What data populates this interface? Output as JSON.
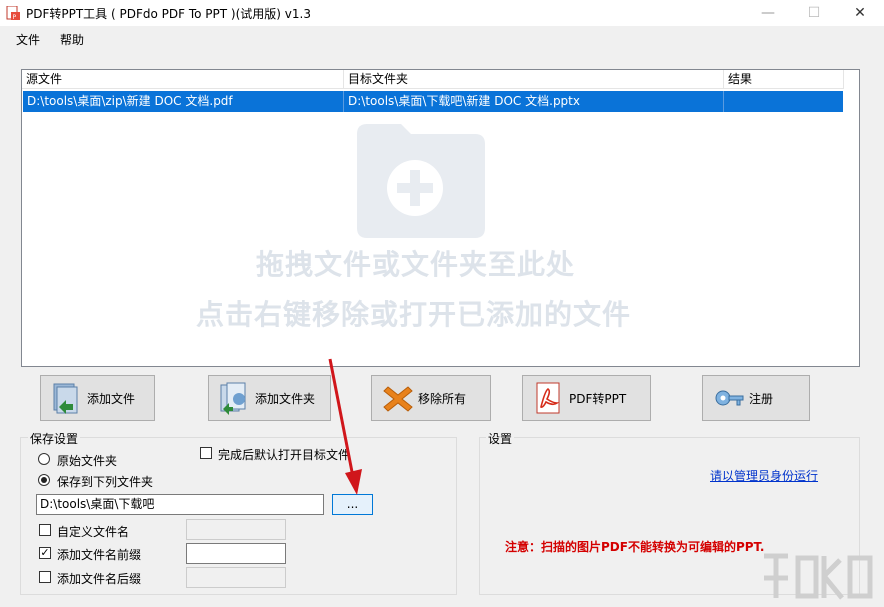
{
  "window": {
    "title": "PDF转PPT工具 ( PDFdo PDF To PPT )(试用版) v1.3",
    "minimize": "—",
    "maximize": "☐",
    "close": "✕"
  },
  "menu": [
    "文件",
    "帮助"
  ],
  "table": {
    "columns": [
      "源文件",
      "目标文件夹",
      "结果"
    ],
    "rows": [
      {
        "source": "D:\\tools\\桌面\\zip\\新建 DOC 文档.pdf",
        "target": "D:\\tools\\桌面\\下载吧\\新建 DOC 文档.pptx",
        "result": ""
      }
    ],
    "hint_line1": "拖拽文件或文件夹至此处",
    "hint_line2": "点击右键移除或打开已添加的文件"
  },
  "buttons": {
    "add_file": "添加文件",
    "add_folder": "添加文件夹",
    "remove_all": "移除所有",
    "convert": "PDF转PPT",
    "register": "注册"
  },
  "save_settings": {
    "title": "保存设置",
    "original_folder": "原始文件夹",
    "save_to_folder": "保存到下列文件夹",
    "open_after": "完成后默认打开目标文件",
    "path": "D:\\tools\\桌面\\下载吧",
    "browse": "...",
    "custom_name": "自定义文件名",
    "add_prefix": "添加文件名前缀",
    "add_suffix": "添加文件名后缀",
    "selected_option": "save_to_folder",
    "custom_name_checked": false,
    "prefix_checked": true,
    "suffix_checked": false,
    "open_after_checked": false
  },
  "settings": {
    "title": "设置",
    "admin_link": "请以管理员身份运行",
    "notice": "注意：扫描的图片PDF不能转换为可编辑的PPT."
  },
  "colors": {
    "selection": "#0a73d8",
    "link": "#0033cc",
    "notice": "#d40000",
    "arrow": "#d0161b",
    "hint": "#dde3ea"
  }
}
